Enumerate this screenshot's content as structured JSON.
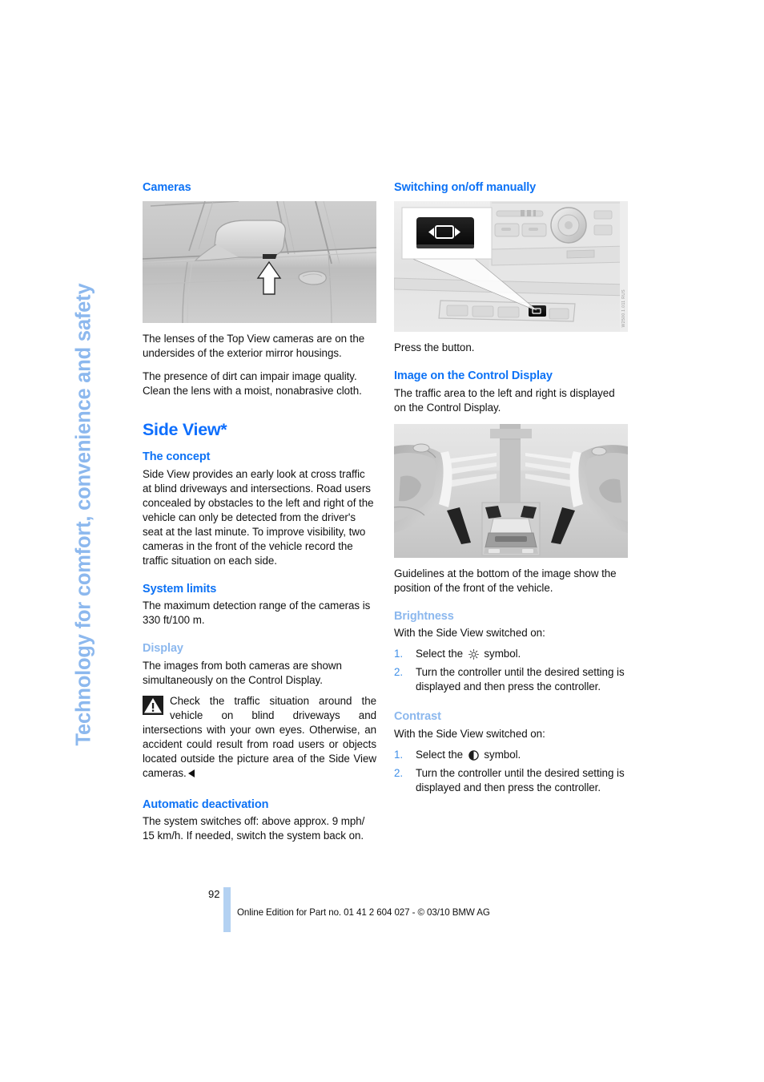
{
  "chapter": {
    "tab_label": "Technology for comfort, convenience and safety",
    "tab_color": "#8cb8ee"
  },
  "colors": {
    "heading_strong": "#0d72f5",
    "heading_light": "#8cb8ee",
    "section_title": "#0d6efd",
    "list_number": "#3f8fe8",
    "footer_bar": "#b3d1f2"
  },
  "left_column": {
    "cameras": {
      "heading": "Cameras",
      "figure": {
        "name": "exterior-mirror-camera-photo",
        "id_label": "W2501.2.11 RUS"
      },
      "paragraph_1": "The lenses of the Top View cameras are on the undersides of the exterior mirror housings.",
      "paragraph_2": "The presence of dirt can impair image quality. Clean the lens with a moist, nonabrasive cloth."
    },
    "side_view": {
      "title": "Side View*",
      "concept": {
        "heading": "The concept",
        "text": "Side View provides an early look at cross traffic at blind driveways and intersections. Road users concealed by obstacles to the left and right of the vehicle can only be detected from the driver's seat at the last minute. To improve visibility, two cameras in the front of the vehicle record the traffic situation on each side."
      },
      "system_limits": {
        "heading": "System limits",
        "text": "The maximum detection range of the cameras is 330 ft/100 m."
      },
      "display": {
        "heading": "Display",
        "text": "The images from both cameras are shown simultaneously on the Control Display.",
        "warning": "Check the traffic situation around the vehicle on blind driveways and intersections with your own eyes. Otherwise, an accident could result from road users or objects located outside the picture area of the Side View cameras."
      },
      "automatic_deactivation": {
        "heading": "Automatic deactivation",
        "text": "The system switches off: above approx. 9 mph/ 15 km/h. If needed, switch the system back on."
      }
    }
  },
  "right_column": {
    "switching": {
      "heading": "Switching on/off manually",
      "figure": {
        "name": "center-console-side-view-button-photo",
        "id_label": "W2500.1.011 RUS"
      },
      "text": "Press the button."
    },
    "image_control_display": {
      "heading": "Image on the Control Display",
      "text": "The traffic area to the left and right is displayed on the Control Display.",
      "figure": {
        "name": "control-display-side-view-image"
      },
      "caption": "Guidelines at the bottom of the image show the position of the front of the vehicle."
    },
    "brightness": {
      "heading": "Brightness",
      "intro": "With the Side View switched on:",
      "steps": [
        {
          "num": "1.",
          "before": "Select the",
          "symbol": "brightness-sun-icon",
          "after": "symbol."
        },
        {
          "num": "2.",
          "before": "Turn the controller until the desired setting is displayed and then press the controller.",
          "symbol": "",
          "after": ""
        }
      ]
    },
    "contrast": {
      "heading": "Contrast",
      "intro": "With the Side View switched on:",
      "steps": [
        {
          "num": "1.",
          "before": "Select the",
          "symbol": "contrast-half-circle-icon",
          "after": "symbol."
        },
        {
          "num": "2.",
          "before": "Turn the controller until the desired setting is displayed and then press the controller.",
          "symbol": "",
          "after": ""
        }
      ]
    }
  },
  "footer": {
    "page_number": "92",
    "edition_text": "Online Edition for Part no. 01 41 2 604 027 - © 03/10 BMW AG"
  }
}
